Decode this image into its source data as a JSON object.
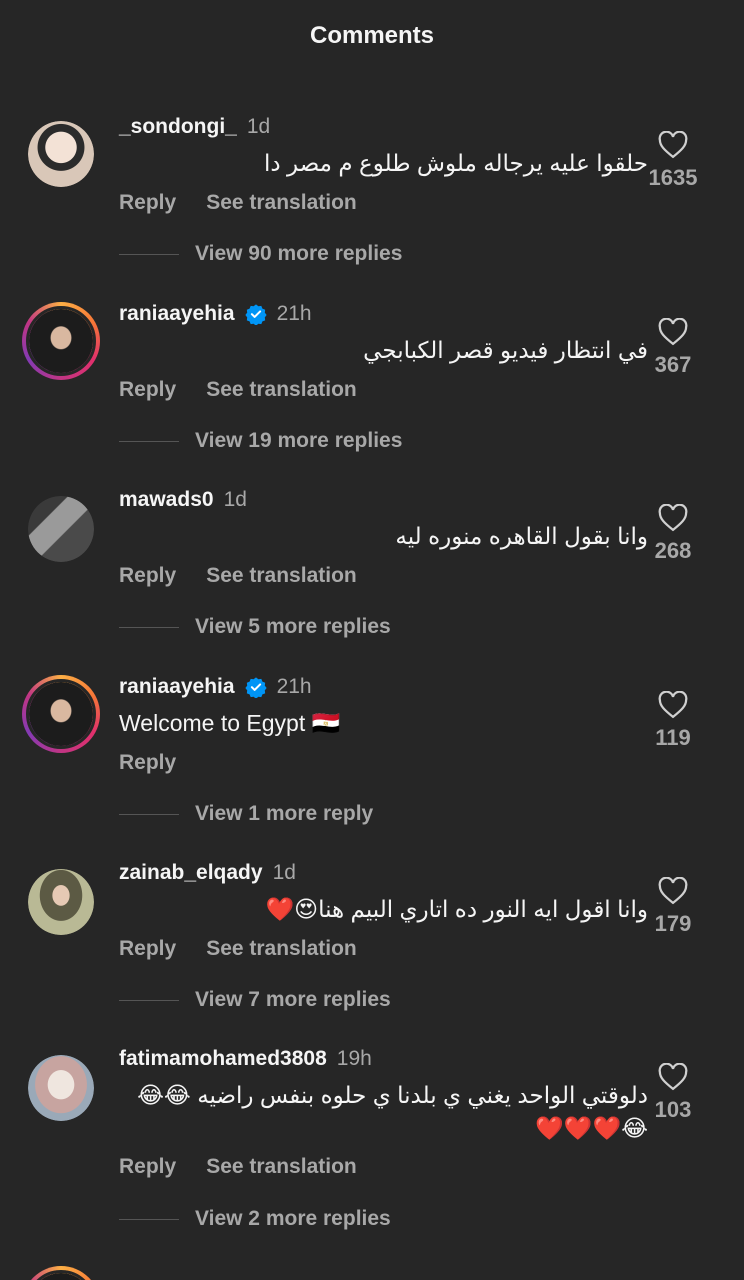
{
  "header": {
    "title": "Comments"
  },
  "comments": [
    {
      "username": "_sondongi_",
      "time": "1d",
      "verified": false,
      "text": "حلقوا عليه يرجاله ملوش طلوع م مصر دا",
      "reply_label": "Reply",
      "translate_label": "See translation",
      "view_replies": "View 90 more replies",
      "likes": "1635"
    },
    {
      "username": "raniaayehia",
      "time": "21h",
      "verified": true,
      "text": "في انتظار فيديو قصر الكبابجي",
      "reply_label": "Reply",
      "translate_label": "See translation",
      "view_replies": "View 19 more replies",
      "likes": "367"
    },
    {
      "username": "mawads0",
      "time": "1d",
      "verified": false,
      "text": "وانا بقول القاهره منوره ليه",
      "reply_label": "Reply",
      "translate_label": "See translation",
      "view_replies": "View 5 more replies",
      "likes": "268"
    },
    {
      "username": "raniaayehia",
      "time": "21h",
      "verified": true,
      "text": "Welcome to Egypt 🇪🇬",
      "reply_label": "Reply",
      "view_replies": "View 1 more reply",
      "likes": "119"
    },
    {
      "username": "zainab_elqady",
      "time": "1d",
      "verified": false,
      "text": "وانا اقول ايه النور ده اتاري البيم هنا😍❤️",
      "reply_label": "Reply",
      "translate_label": "See translation",
      "view_replies": "View 7 more replies",
      "likes": "179"
    },
    {
      "username": "fatimamohamed3808",
      "time": "19h",
      "verified": false,
      "text": "دلوقتي الواحد يغني ي بلدنا ي حلوه بنفس راضيه 😂😂 😂❤️❤️❤️",
      "reply_label": "Reply",
      "translate_label": "See translation",
      "view_replies": "View 2 more replies",
      "likes": "103"
    }
  ],
  "colors": {
    "background": "#262626",
    "muted": "#a8a8a8",
    "verified": "#0095f6"
  },
  "icons": {
    "like": "heart-outline-icon",
    "verified": "verified-badge-icon"
  }
}
